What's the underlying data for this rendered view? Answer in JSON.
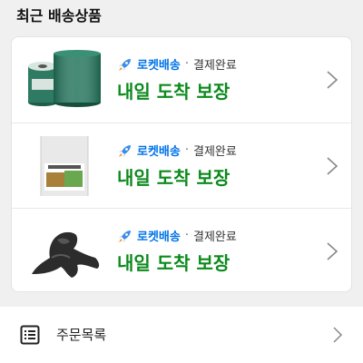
{
  "section": {
    "title": "최근 배송상품"
  },
  "items": [
    {
      "product_icon": "green-thread-spools-image",
      "delivery_type": "로켓배송",
      "separator": "·",
      "payment_status": "결제완료",
      "arrival": "내일 도착 보장"
    },
    {
      "product_icon": "seed-pouch-image",
      "delivery_type": "로켓배송",
      "separator": "·",
      "payment_status": "결제완료",
      "arrival": "내일 도착 보장"
    },
    {
      "product_icon": "driftwood-image",
      "delivery_type": "로켓배송",
      "separator": "·",
      "payment_status": "결제완료",
      "arrival": "내일 도착 보장"
    }
  ],
  "menu": {
    "order_list_label": "주문목록",
    "icon": "list-icon"
  },
  "colors": {
    "rocket_blue": "#0073e9",
    "arrival_green": "#0c8a1d"
  }
}
